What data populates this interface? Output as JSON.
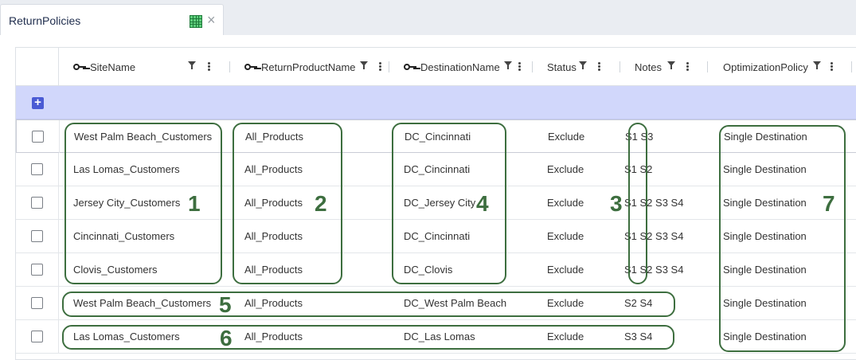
{
  "tab": {
    "title": "ReturnPolicies",
    "grid_icon": "grid-icon",
    "close_icon": "close-icon",
    "close_glyph": "×"
  },
  "columns": [
    {
      "label": "SiteName",
      "key": true
    },
    {
      "label": "ReturnProductName",
      "key": true
    },
    {
      "label": "DestinationName",
      "key": true
    },
    {
      "label": "Status",
      "key": false
    },
    {
      "label": "Notes",
      "key": false
    },
    {
      "label": "OptimizationPolicy",
      "key": false
    }
  ],
  "add_row": {
    "glyph": "+"
  },
  "rows": [
    {
      "site": "West Palm Beach_Customers",
      "product": "All_Products",
      "destination": "DC_Cincinnati",
      "status": "Exclude",
      "notes": "S1 S3",
      "policy": "Single Destination"
    },
    {
      "site": "Las Lomas_Customers",
      "product": "All_Products",
      "destination": "DC_Cincinnati",
      "status": "Exclude",
      "notes": "S1 S2",
      "policy": "Single Destination"
    },
    {
      "site": "Jersey City_Customers",
      "product": "All_Products",
      "destination": "DC_Jersey City",
      "status": "Exclude",
      "notes": "S1 S2 S3 S4",
      "policy": "Single Destination"
    },
    {
      "site": "Cincinnati_Customers",
      "product": "All_Products",
      "destination": "DC_Cincinnati",
      "status": "Exclude",
      "notes": "S1 S2 S3 S4",
      "policy": "Single Destination"
    },
    {
      "site": "Clovis_Customers",
      "product": "All_Products",
      "destination": "DC_Clovis",
      "status": "Exclude",
      "notes": "S1 S2 S3 S4",
      "policy": "Single Destination"
    },
    {
      "site": "West Palm Beach_Customers",
      "product": "All_Products",
      "destination": "DC_West Palm Beach",
      "status": "Exclude",
      "notes": "S2 S4",
      "policy": "Single Destination"
    },
    {
      "site": "Las Lomas_Customers",
      "product": "All_Products",
      "destination": "DC_Las Lomas",
      "status": "Exclude",
      "notes": "S3 S4",
      "policy": "Single Destination"
    }
  ],
  "annotations": [
    "1",
    "2",
    "3",
    "4",
    "5",
    "6",
    "7"
  ],
  "colors": {
    "annotation": "#3d6e3f",
    "add_row_bg": "#d1d7fb",
    "add_button": "#4a5bd4"
  }
}
